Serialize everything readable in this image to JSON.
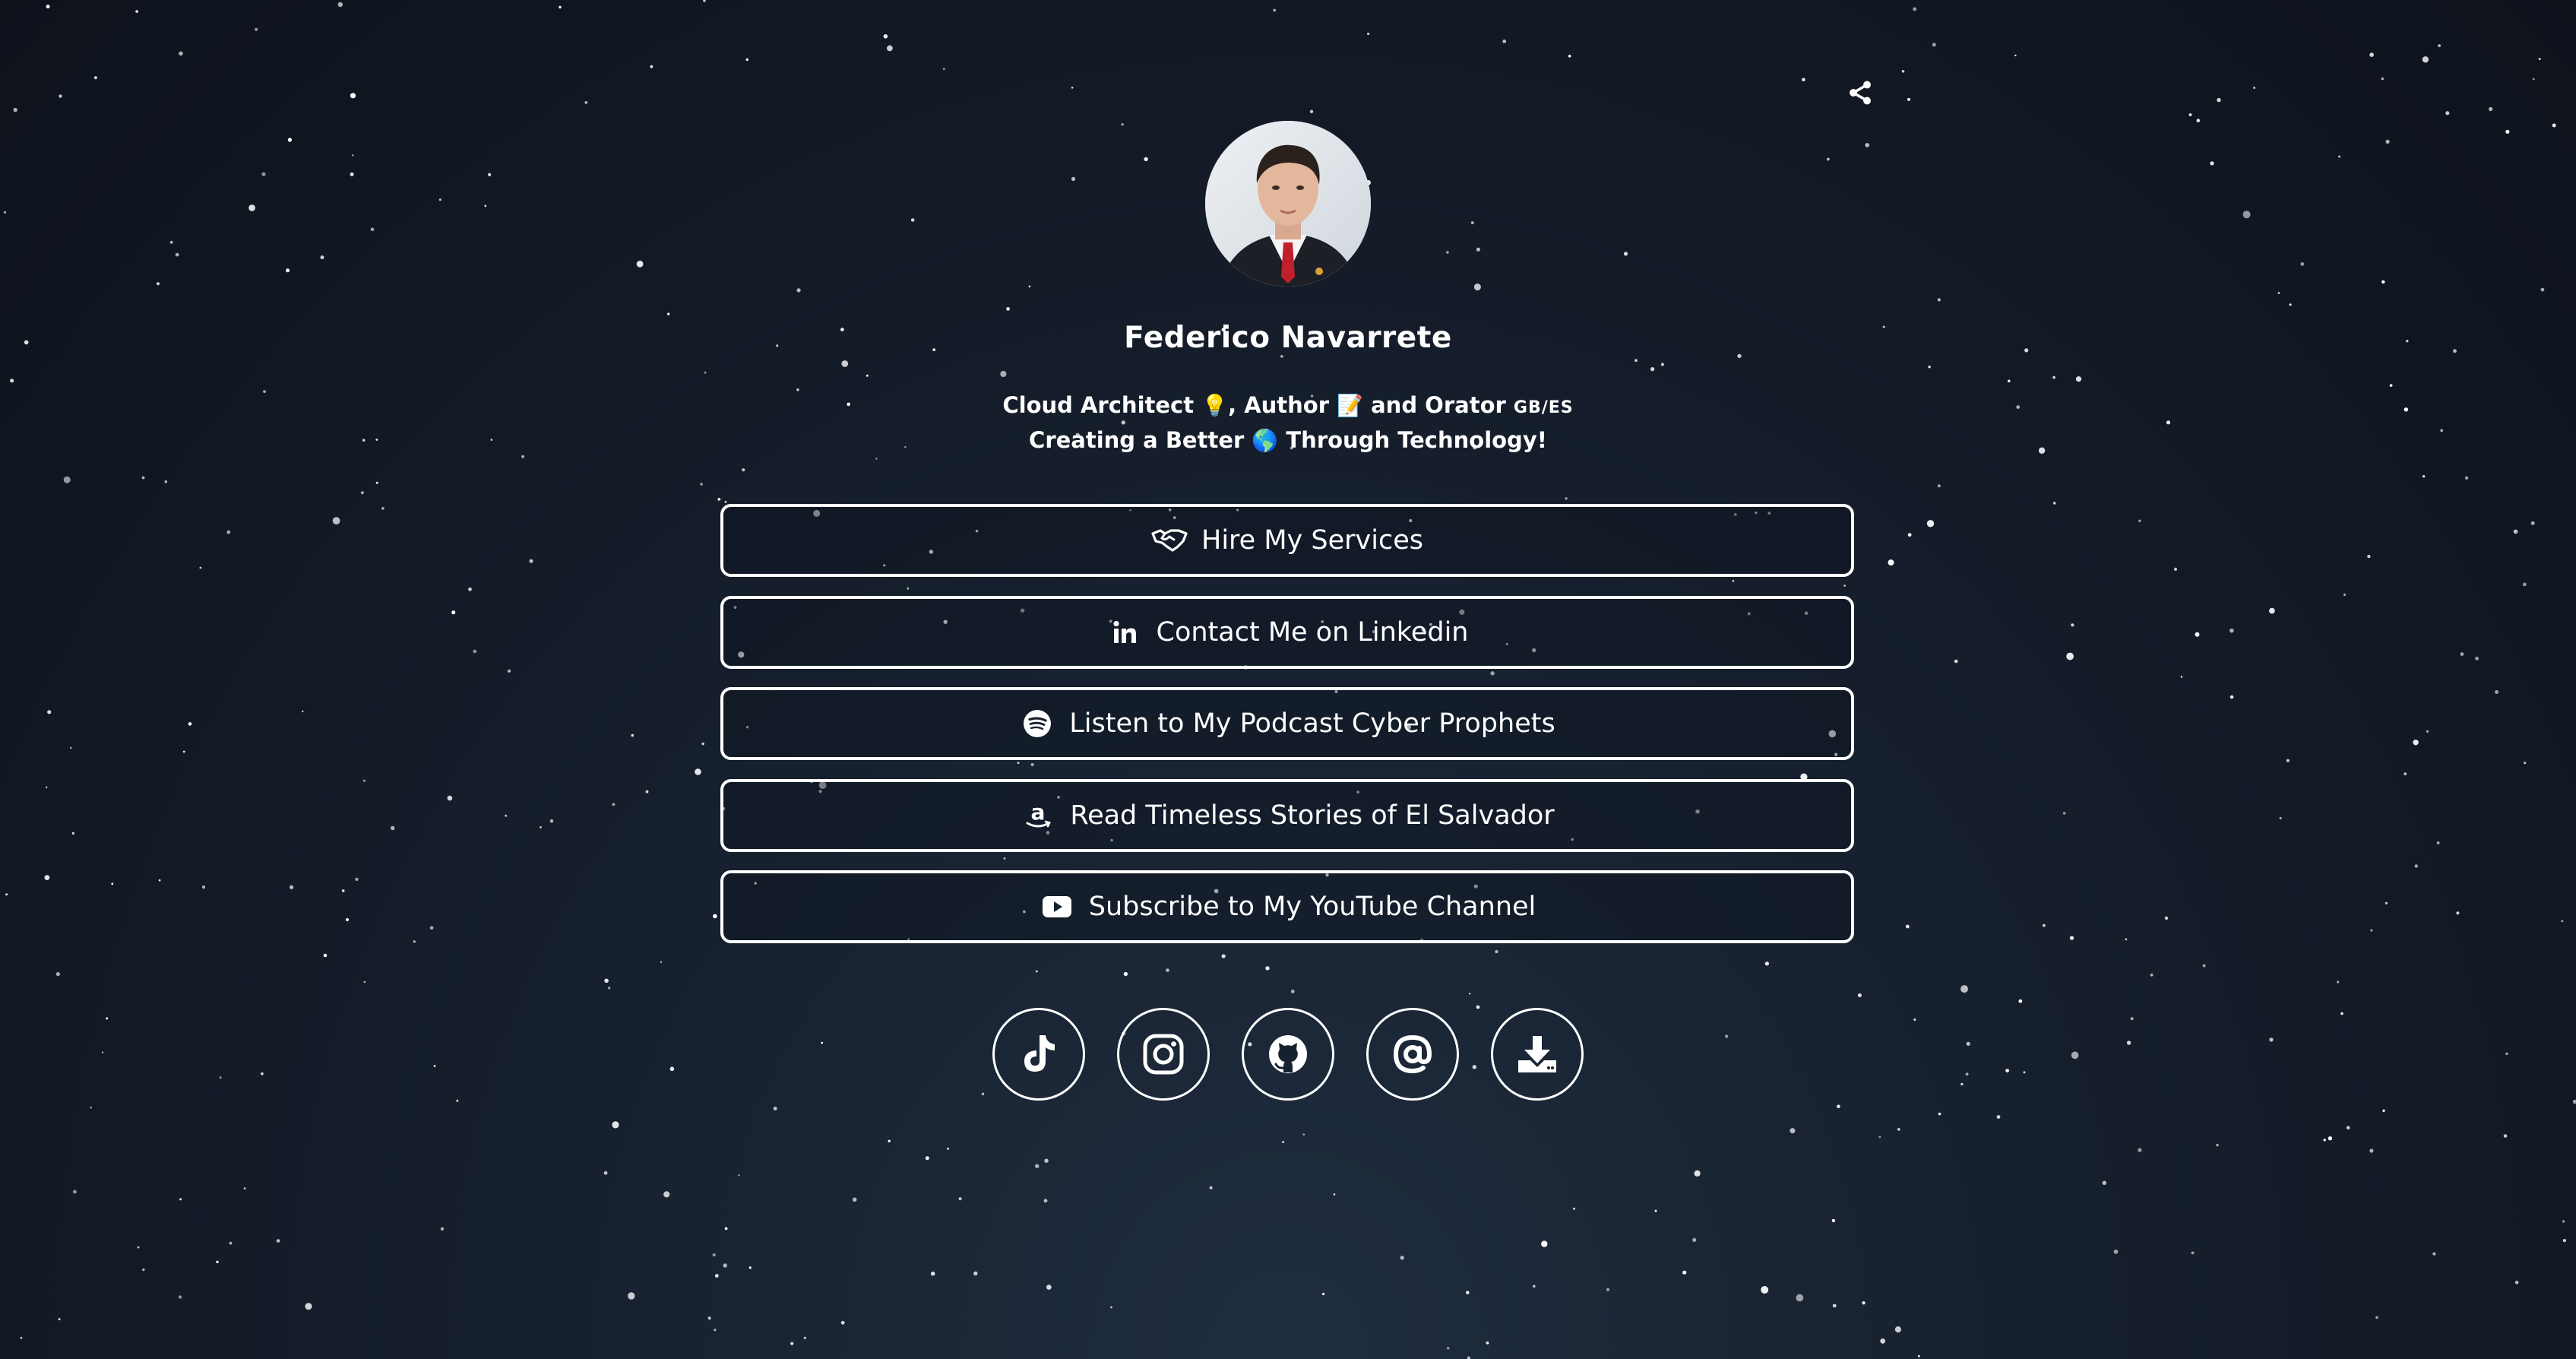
{
  "profile": {
    "name": "Federico Navarrete",
    "bio_line1": {
      "part1": "Cloud Architect",
      "emoji1": "💡",
      "part2": ", Author",
      "emoji2": "📝",
      "part3": " and Orator",
      "flags": "GB/ES"
    },
    "bio_line2": {
      "part1": "Creating a Better",
      "emoji": "🌎",
      "part2": "Through Technology!"
    }
  },
  "links": [
    {
      "label": "Hire My Services",
      "icon": "handshake-icon"
    },
    {
      "label": "Contact Me on Linkedin",
      "icon": "linkedin-icon"
    },
    {
      "label": "Listen to My Podcast Cyber Prophets",
      "icon": "spotify-icon"
    },
    {
      "label": "Read Timeless Stories of El Salvador",
      "icon": "amazon-icon"
    },
    {
      "label": "Subscribe to My YouTube Channel",
      "icon": "youtube-icon"
    }
  ],
  "socials": [
    {
      "icon": "tiktok-icon"
    },
    {
      "icon": "instagram-icon"
    },
    {
      "icon": "github-icon"
    },
    {
      "icon": "email-at-icon"
    },
    {
      "icon": "download-icon"
    }
  ],
  "header": {
    "share_icon": "share-icon"
  },
  "colors": {
    "background_top": "#0d121b",
    "background_bottom": "#1f2d3f",
    "text": "#ffffff",
    "button_border": "#ffffff"
  }
}
